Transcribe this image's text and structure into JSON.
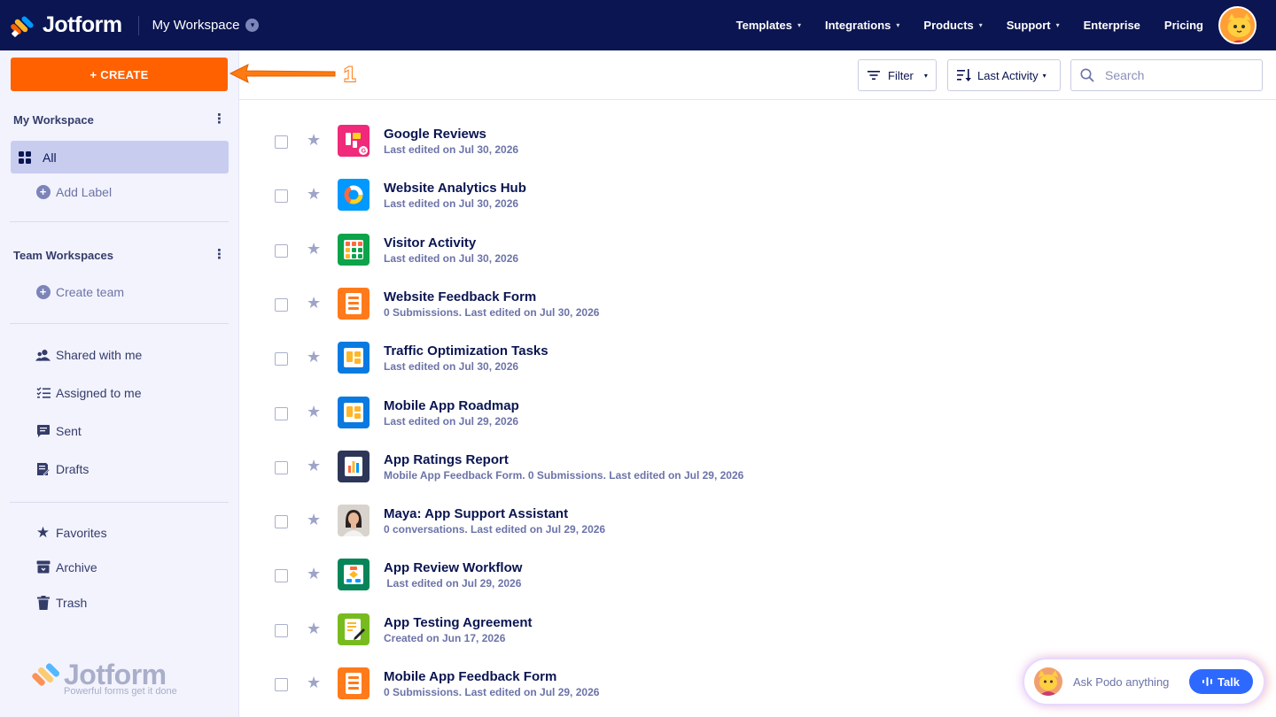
{
  "topbar": {
    "brand": "Jotform",
    "workspace": "My Workspace",
    "nav": [
      {
        "label": "Templates",
        "dropdown": true
      },
      {
        "label": "Integrations",
        "dropdown": true
      },
      {
        "label": "Products",
        "dropdown": true
      },
      {
        "label": "Support",
        "dropdown": true
      },
      {
        "label": "Enterprise",
        "dropdown": false
      },
      {
        "label": "Pricing",
        "dropdown": false
      }
    ]
  },
  "sidebar": {
    "create_label": "+ CREATE",
    "annotation_number": "1",
    "my_workspace_title": "My Workspace",
    "all_label": "All",
    "add_label": "Add Label",
    "team_workspaces_title": "Team Workspaces",
    "create_team": "Create team",
    "shared_with_me": "Shared with me",
    "assigned_to_me": "Assigned to me",
    "sent": "Sent",
    "drafts": "Drafts",
    "favorites": "Favorites",
    "archive": "Archive",
    "trash": "Trash",
    "bottom_brand": "Jotform",
    "bottom_tagline": "Powerful forms get it done"
  },
  "toolbar": {
    "filter_label": "Filter",
    "sort_label": "Last Activity",
    "search_placeholder": "Search"
  },
  "items": [
    {
      "title": "Google Reviews",
      "subtitle": "Last edited on Jul 30, 2026",
      "icon": "google-reviews-icon",
      "color": "#f0297a"
    },
    {
      "title": "Website Analytics Hub",
      "subtitle": "Last edited on Jul 30, 2026",
      "icon": "analytics-donut-icon",
      "color": "#0099ff"
    },
    {
      "title": "Visitor Activity",
      "subtitle": "Last edited on Jul 30, 2026",
      "icon": "table-grid-icon",
      "color": "#0ca34a"
    },
    {
      "title": "Website Feedback Form",
      "subtitle": "0 Submissions. Last edited on Jul 30, 2026",
      "icon": "form-icon",
      "color": "#ff7a1a"
    },
    {
      "title": "Traffic Optimization Tasks",
      "subtitle": "Last edited on Jul 30, 2026",
      "icon": "board-icon",
      "color": "#0a7ae0"
    },
    {
      "title": "Mobile App Roadmap",
      "subtitle": "Last edited on Jul 29, 2026",
      "icon": "board-icon",
      "color": "#0a7ae0"
    },
    {
      "title": "App Ratings Report",
      "subtitle": "Mobile App Feedback Form. 0 Submissions. Last edited on Jul 29, 2026",
      "icon": "report-chart-icon",
      "color": "#2d3658"
    },
    {
      "title": "Maya: App Support Assistant",
      "subtitle": "0 conversations. Last edited on Jul 29, 2026",
      "icon": "agent-avatar-icon",
      "color": "#d8d3cc"
    },
    {
      "title": "App Review Workflow",
      "subtitle": " Last edited on Jul 29, 2026",
      "icon": "workflow-icon",
      "color": "#088558"
    },
    {
      "title": "App Testing Agreement",
      "subtitle": "Created on Jun 17, 2026",
      "icon": "sign-document-icon",
      "color": "#78bb1e"
    },
    {
      "title": "Mobile App Feedback Form",
      "subtitle": "0 Submissions. Last edited on Jul 29, 2026",
      "icon": "form-icon",
      "color": "#ff7a1a"
    }
  ],
  "podo": {
    "prompt": "Ask Podo anything",
    "talk_label": "Talk"
  }
}
